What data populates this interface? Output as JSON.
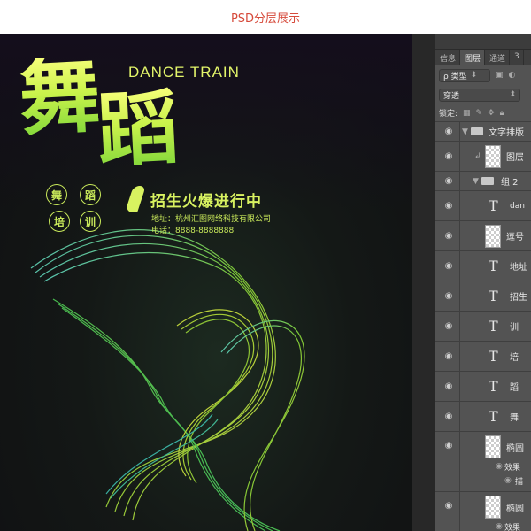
{
  "header": {
    "title": "PSD分层展示"
  },
  "poster": {
    "title_char_1": "舞",
    "title_char_2": "蹈",
    "subtitle_en": "DANCE TRAIN",
    "circle_chars": [
      "舞",
      "蹈",
      "培",
      "训"
    ],
    "slogan": "招生火爆进行中",
    "address": "地址：杭州汇图网络科技有限公司",
    "phone": "电话：8888-8888888"
  },
  "layers_panel": {
    "tabs": [
      "信息",
      "图层",
      "通道",
      "3"
    ],
    "active_tab": "图层",
    "filter_label": "ρ 类型",
    "blend_mode": "穿透",
    "lock_label": "锁定:",
    "layers": [
      {
        "name": "文字排版"
      },
      {
        "name": "图层"
      },
      {
        "name": "组 2"
      },
      {
        "name": "dan"
      },
      {
        "name": "逗号"
      },
      {
        "name": "地址"
      },
      {
        "name": "招生"
      },
      {
        "name": "训"
      },
      {
        "name": "培"
      },
      {
        "name": "蹈"
      },
      {
        "name": "舞"
      },
      {
        "name": "椭圆"
      },
      {
        "name": "效果"
      },
      {
        "name": "描"
      },
      {
        "name": "椭圆"
      },
      {
        "name": "效果"
      }
    ]
  },
  "colors": {
    "header_text": "#d64a3b",
    "title_gradient_top": "#f7ff7a",
    "title_gradient_bottom": "#7fd63a",
    "accent_green": "#d8f260",
    "panel_bg": "#535353"
  }
}
